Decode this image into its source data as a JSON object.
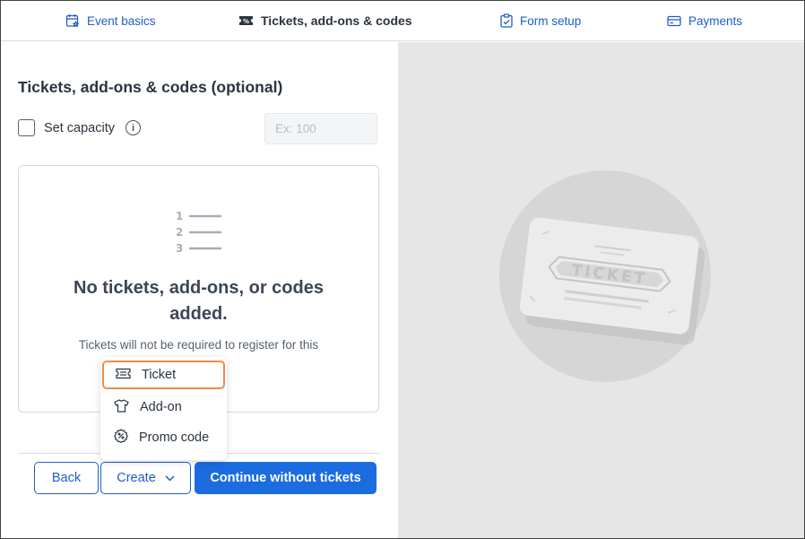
{
  "tabs": [
    {
      "label": "Event basics",
      "icon": "calendar-star-icon"
    },
    {
      "label": "Tickets, add-ons & codes",
      "icon": "ticket-icon",
      "active": true
    },
    {
      "label": "Form setup",
      "icon": "clipboard-check-icon"
    },
    {
      "label": "Payments",
      "icon": "credit-card-icon"
    }
  ],
  "section": {
    "title": "Tickets, add-ons & codes (optional)"
  },
  "capacity": {
    "label": "Set capacity",
    "placeholder": "Ex: 100",
    "checked": false
  },
  "empty": {
    "list_numbers": [
      "1",
      "2",
      "3"
    ],
    "title": "No tickets, add-ons, or codes added.",
    "subtitle": "Tickets will not be required to register for this"
  },
  "menu": {
    "items": [
      {
        "label": "Ticket",
        "icon": "ticket-icon"
      },
      {
        "label": "Add-on",
        "icon": "tshirt-icon"
      },
      {
        "label": "Promo code",
        "icon": "percent-badge-icon"
      }
    ]
  },
  "buttons": {
    "back": "Back",
    "create": "Create",
    "continue": "Continue without tickets"
  },
  "illustration": {
    "ticket_text": "TICKET"
  },
  "colors": {
    "accent": "#1a6cdf",
    "link": "#1e5fc6",
    "focus": "#f08a4b",
    "panel_bg": "#e6e6e6"
  }
}
